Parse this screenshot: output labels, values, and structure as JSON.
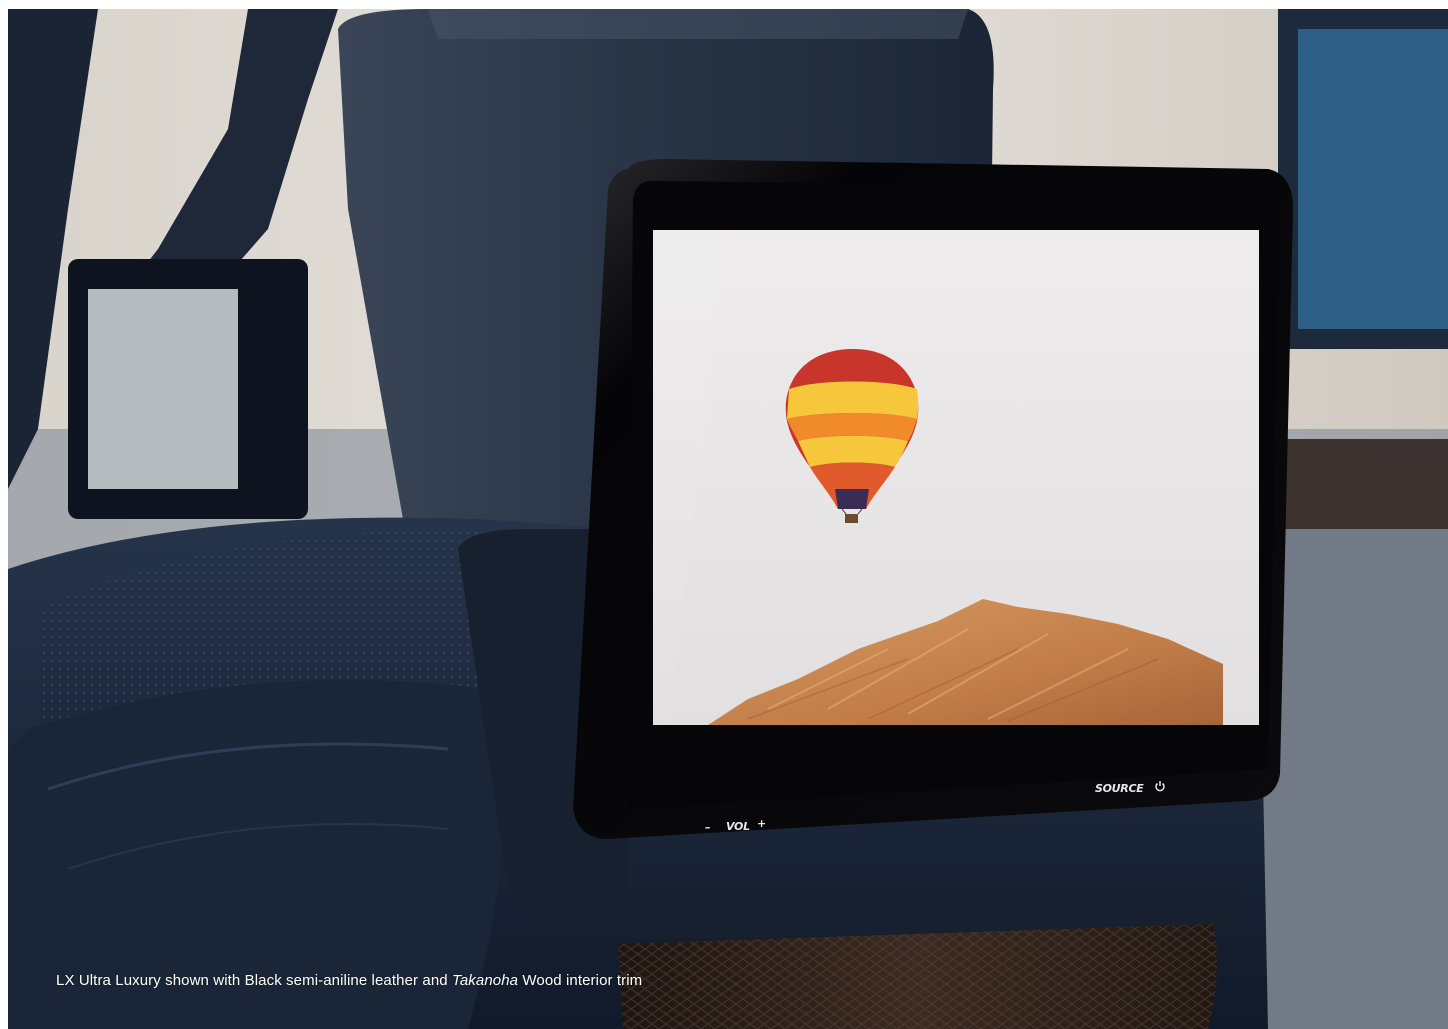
{
  "photo": {
    "subject": "rear-seat-entertainment-screen",
    "colors": {
      "leather": "#1f2b3e",
      "leather_dark": "#0f1725",
      "screen_bezel": "#0a0a0c",
      "sky": "#e9e6e6",
      "rock": "#c98a55",
      "balloon_red": "#c8352b",
      "balloon_orange": "#f08a2a",
      "balloon_yellow": "#f6c63b",
      "wood_trim": "#2a1f1a"
    }
  },
  "screen_controls": {
    "vol_minus": "–",
    "vol_label": "VOL",
    "vol_plus": "+",
    "source_label": "SOURCE",
    "power_icon": "power-icon"
  },
  "caption": {
    "before": "LX Ultra Luxury shown with Black semi-aniline leather and ",
    "italic": "Takanoha",
    "after": " Wood interior trim"
  }
}
